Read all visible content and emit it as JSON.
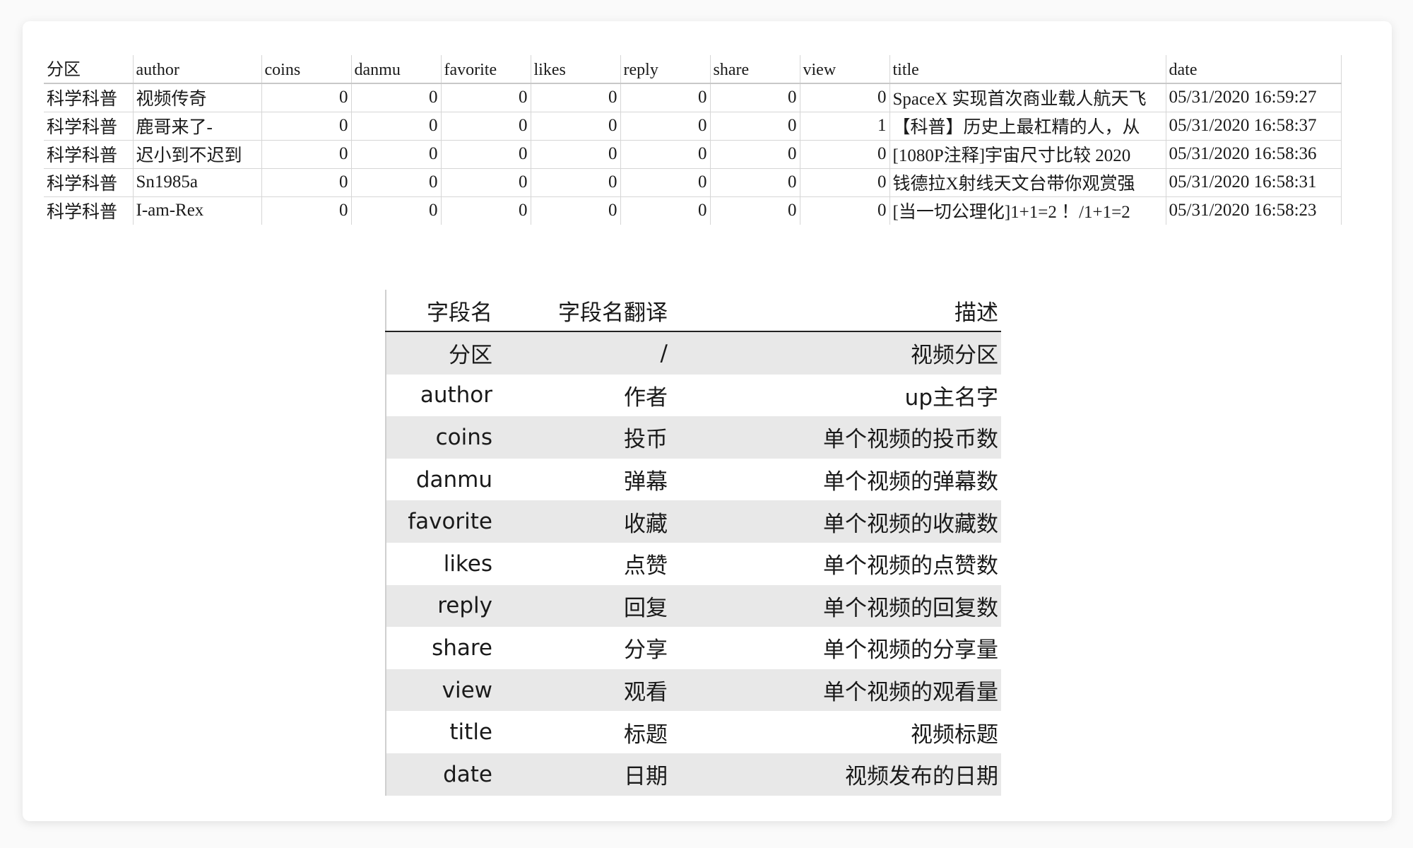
{
  "sheet": {
    "headers": [
      "分区",
      "author",
      "coins",
      "danmu",
      "favorite",
      "likes",
      "reply",
      "share",
      "view",
      "title",
      "date"
    ],
    "rows": [
      [
        "科学科普",
        "视频传奇",
        "0",
        "0",
        "0",
        "0",
        "0",
        "0",
        "0",
        "SpaceX 实现首次商业载人航天飞",
        "05/31/2020 16:59:27"
      ],
      [
        "科学科普",
        "鹿哥来了-",
        "0",
        "0",
        "0",
        "0",
        "0",
        "0",
        "1",
        "【科普】历史上最杠精的人，从",
        "05/31/2020 16:58:37"
      ],
      [
        "科学科普",
        "迟小到不迟到",
        "0",
        "0",
        "0",
        "0",
        "0",
        "0",
        "0",
        "[1080P注释]宇宙尺寸比较 2020",
        "05/31/2020 16:58:36"
      ],
      [
        "科学科普",
        "Sn1985a",
        "0",
        "0",
        "0",
        "0",
        "0",
        "0",
        "0",
        "钱德拉X射线天文台带你观赏强",
        "05/31/2020 16:58:31"
      ],
      [
        "科学科普",
        "I-am-Rex",
        "0",
        "0",
        "0",
        "0",
        "0",
        "0",
        "0",
        "[当一切公理化]1+1=2 ！/1+1=2",
        "05/31/2020 16:58:23"
      ]
    ]
  },
  "fields": {
    "headers": [
      "字段名",
      "字段名翻译",
      "描述"
    ],
    "rows": [
      [
        "分区",
        "/",
        "视频分区"
      ],
      [
        "author",
        "作者",
        "up主名字"
      ],
      [
        "coins",
        "投币",
        "单个视频的投币数"
      ],
      [
        "danmu",
        "弹幕",
        "单个视频的弹幕数"
      ],
      [
        "favorite",
        "收藏",
        "单个视频的收藏数"
      ],
      [
        "likes",
        "点赞",
        "单个视频的点赞数"
      ],
      [
        "reply",
        "回复",
        "单个视频的回复数"
      ],
      [
        "share",
        "分享",
        "单个视频的分享量"
      ],
      [
        "view",
        "观看",
        "单个视频的观看量"
      ],
      [
        "title",
        "标题",
        "视频标题"
      ],
      [
        "date",
        "日期",
        "视频发布的日期"
      ]
    ]
  }
}
